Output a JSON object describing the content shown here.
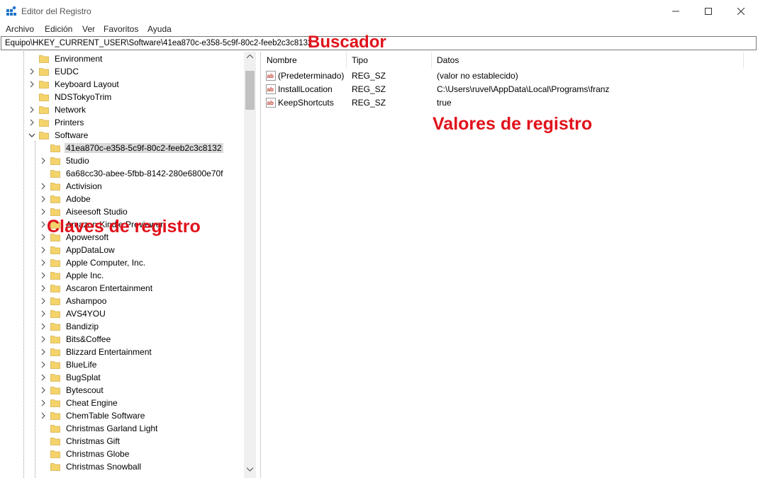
{
  "window": {
    "title": "Editor del Registro",
    "controls": [
      "minimize-icon",
      "maximize-icon",
      "close-icon"
    ]
  },
  "menu": [
    "Archivo",
    "Edición",
    "Ver",
    "Favoritos",
    "Ayuda"
  ],
  "address": {
    "path": "Equipo\\HKEY_CURRENT_USER\\Software\\41ea870c-e358-5c9f-80c2-feeb2c3c8132"
  },
  "annotations": {
    "search": "Buscador",
    "values": "Valores de registro",
    "keys": "Claves de registro"
  },
  "tree": {
    "top_items": [
      {
        "label": "Environment",
        "expander": "none"
      },
      {
        "label": "EUDC",
        "expander": "collapsed"
      },
      {
        "label": "Keyboard Layout",
        "expander": "collapsed"
      },
      {
        "label": "NDSTokyoTrim",
        "expander": "none"
      },
      {
        "label": "Network",
        "expander": "collapsed"
      },
      {
        "label": "Printers",
        "expander": "collapsed"
      },
      {
        "label": "Software",
        "expander": "expanded"
      }
    ],
    "software_children": [
      {
        "label": "41ea870c-e358-5c9f-80c2-feeb2c3c8132",
        "expander": "none",
        "selected": true
      },
      {
        "label": "5tudio",
        "expander": "collapsed"
      },
      {
        "label": "6a68cc30-abee-5fbb-8142-280e6800e70f",
        "expander": "none"
      },
      {
        "label": "Activision",
        "expander": "collapsed"
      },
      {
        "label": "Adobe",
        "expander": "collapsed"
      },
      {
        "label": "Aiseesoft Studio",
        "expander": "collapsed"
      },
      {
        "label": "Amazon Kindle Previewer",
        "expander": "collapsed"
      },
      {
        "label": "Apowersoft",
        "expander": "collapsed"
      },
      {
        "label": "AppDataLow",
        "expander": "collapsed"
      },
      {
        "label": "Apple Computer, Inc.",
        "expander": "collapsed"
      },
      {
        "label": "Apple Inc.",
        "expander": "collapsed"
      },
      {
        "label": "Ascaron Entertainment",
        "expander": "collapsed"
      },
      {
        "label": "Ashampoo",
        "expander": "collapsed"
      },
      {
        "label": "AVS4YOU",
        "expander": "collapsed"
      },
      {
        "label": "Bandizip",
        "expander": "collapsed"
      },
      {
        "label": "Bits&Coffee",
        "expander": "collapsed"
      },
      {
        "label": "Blizzard Entertainment",
        "expander": "collapsed"
      },
      {
        "label": "BlueLife",
        "expander": "collapsed"
      },
      {
        "label": "BugSplat",
        "expander": "collapsed"
      },
      {
        "label": "Bytescout",
        "expander": "collapsed"
      },
      {
        "label": "Cheat Engine",
        "expander": "collapsed"
      },
      {
        "label": "ChemTable Software",
        "expander": "collapsed"
      },
      {
        "label": "Christmas Garland Light",
        "expander": "none"
      },
      {
        "label": "Christmas Gift",
        "expander": "none"
      },
      {
        "label": "Christmas Globe",
        "expander": "none"
      },
      {
        "label": "Christmas Snowball",
        "expander": "none"
      }
    ]
  },
  "values_table": {
    "columns": [
      "Nombre",
      "Tipo",
      "Datos"
    ],
    "rows": [
      {
        "name": "(Predeterminado)",
        "type": "REG_SZ",
        "data": "(valor no establecido)"
      },
      {
        "name": "InstallLocation",
        "type": "REG_SZ",
        "data": "C:\\Users\\ruvel\\AppData\\Local\\Programs\\franz"
      },
      {
        "name": "KeepShortcuts",
        "type": "REG_SZ",
        "data": "true"
      }
    ]
  },
  "colors": {
    "annotation": "#e0121b",
    "folder": "#f4d36b",
    "selection": "#d9d9d9",
    "string_icon": "#c0392b"
  }
}
